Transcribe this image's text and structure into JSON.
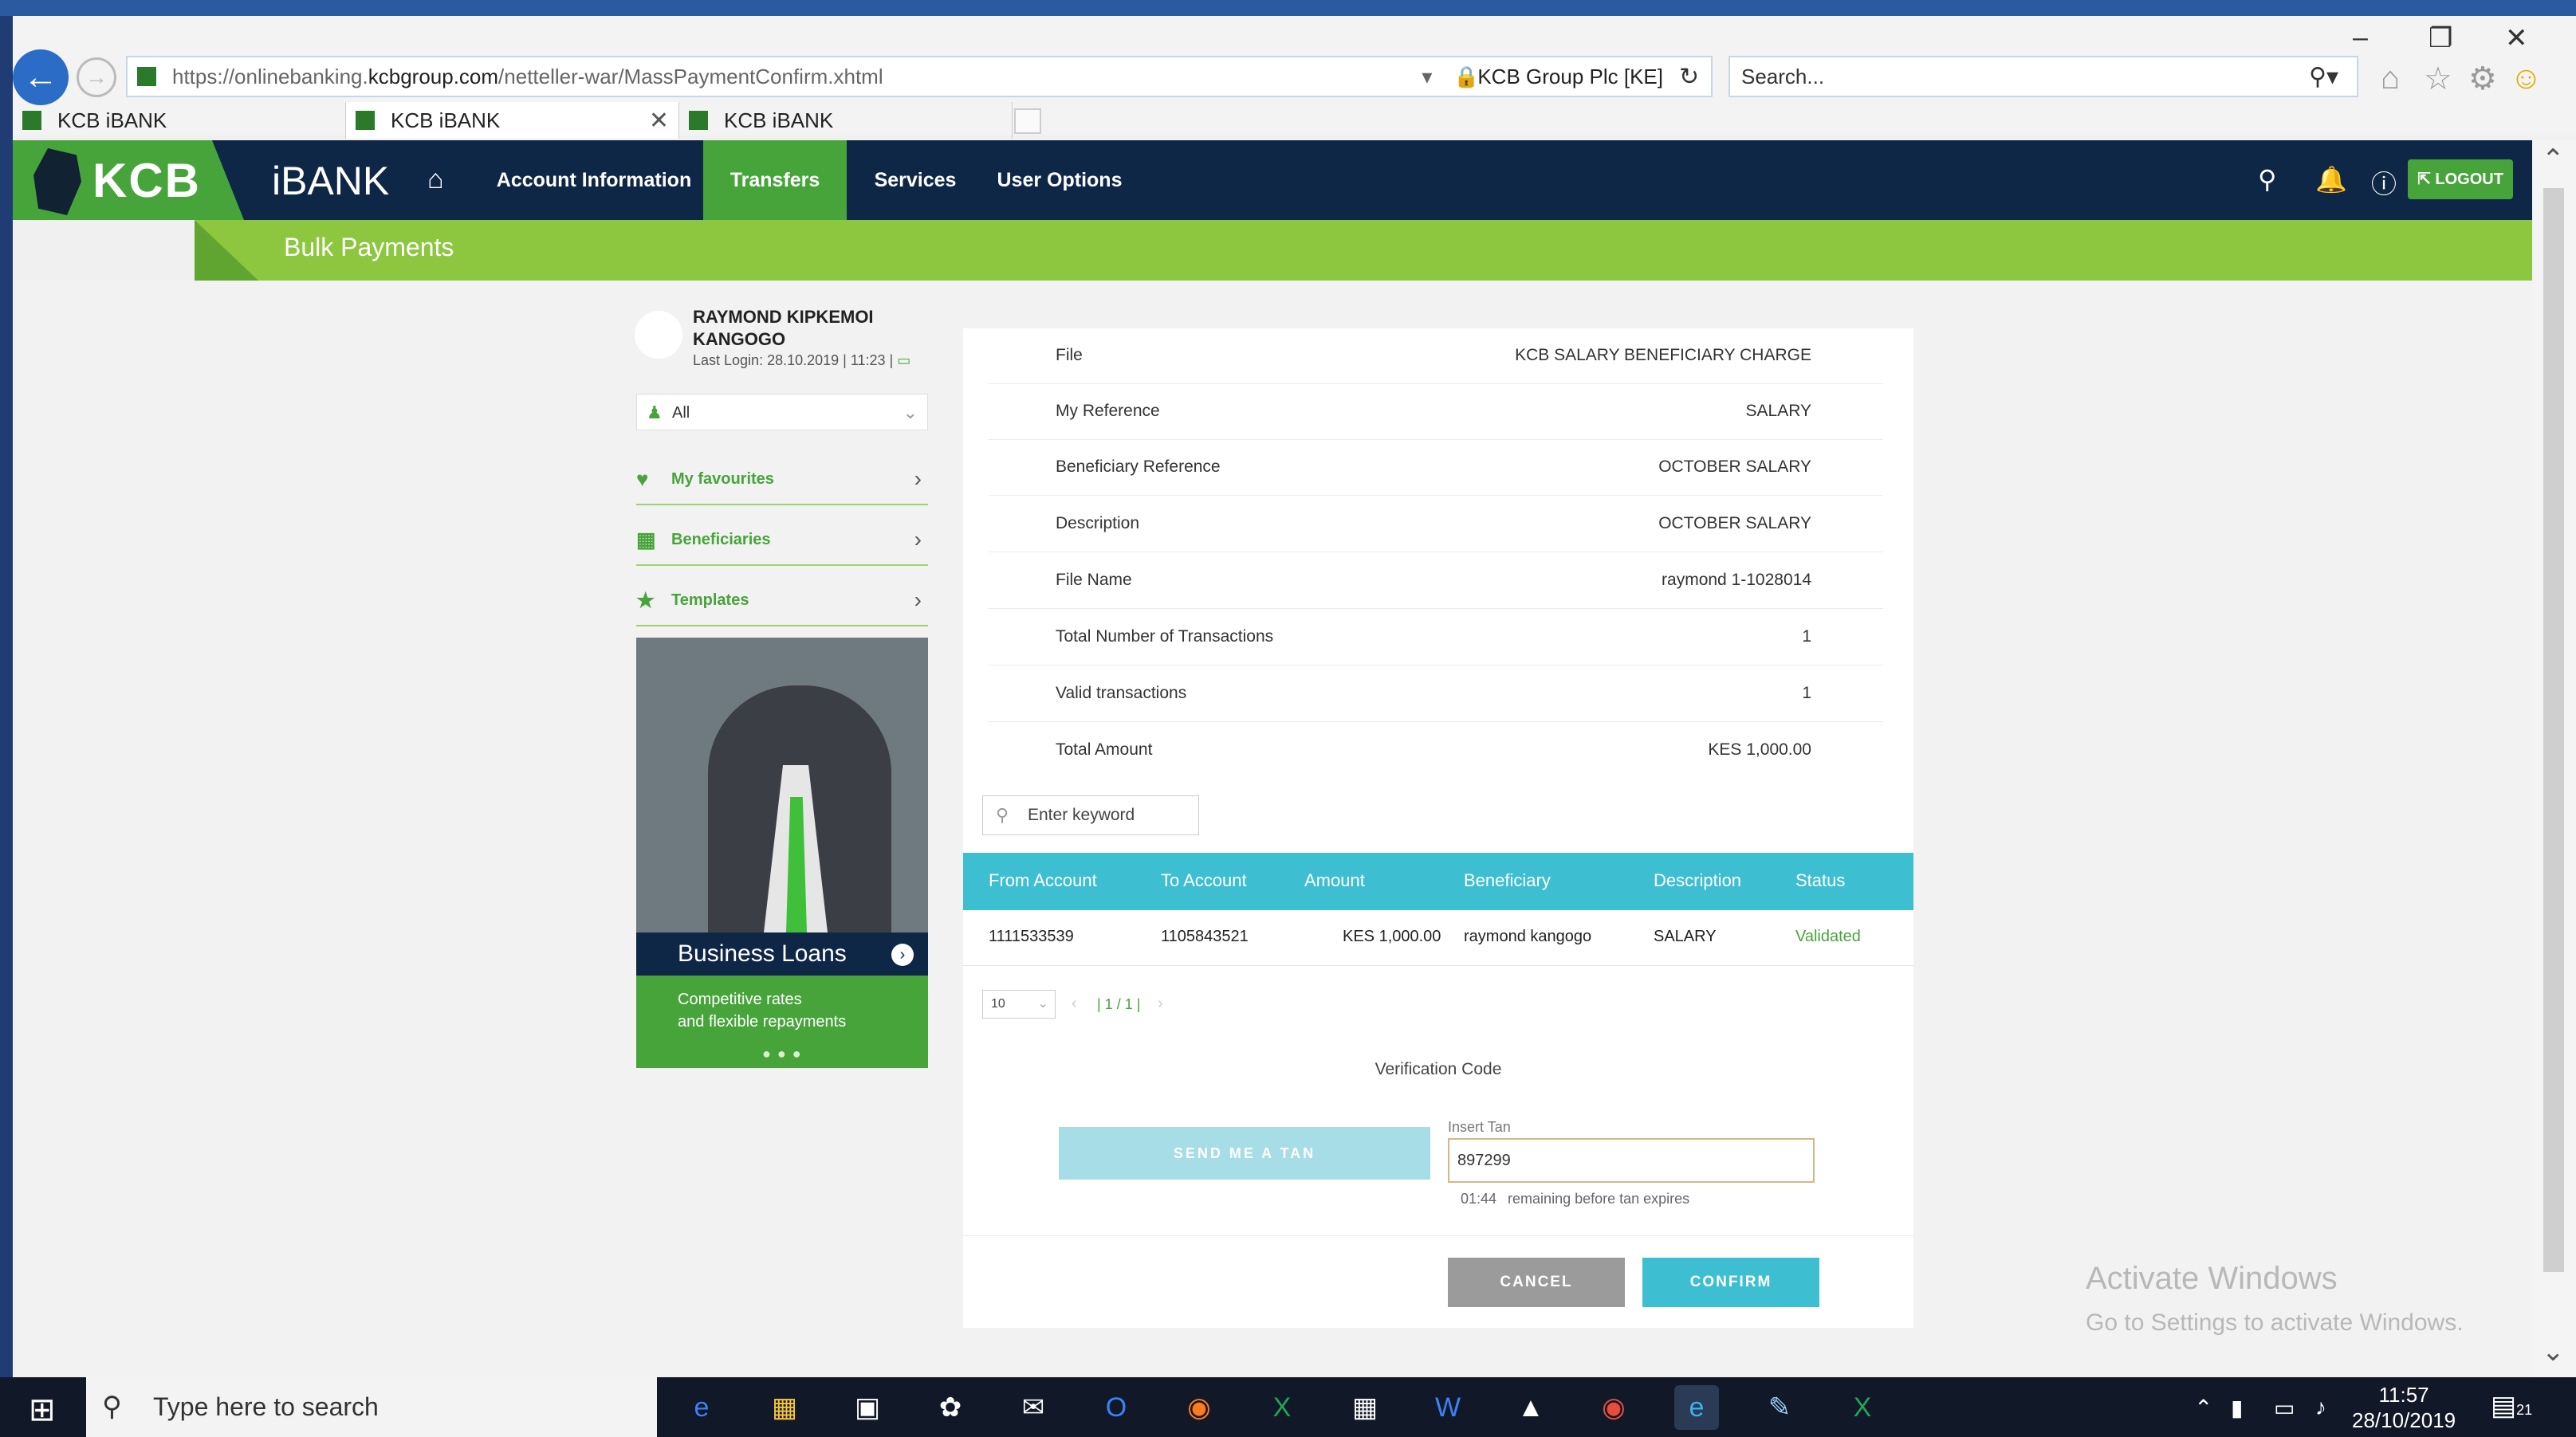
{
  "browser": {
    "url_prefix": "https://onlinebanking.",
    "url_domain": "kcbgroup.com",
    "url_path": "/netteller-war/MassPaymentConfirm.xhtml",
    "site_identity": "KCB Group Plc [KE]",
    "search_placeholder": "Search...",
    "tabs": [
      {
        "label": "KCB iBANK"
      },
      {
        "label": "KCB iBANK"
      },
      {
        "label": "KCB iBANK"
      }
    ]
  },
  "header": {
    "logo": "KCB",
    "product": "iBANK",
    "nav": [
      {
        "label": "Account Information"
      },
      {
        "label": "Transfers"
      },
      {
        "label": "Services"
      },
      {
        "label": "User Options"
      }
    ],
    "logout_label": "LOGOUT"
  },
  "page": {
    "title": "Bulk Payments"
  },
  "sidebar": {
    "user_name": "RAYMOND KIPKEMOI KANGOGO",
    "last_login": "Last Login: 28.10.2019 | 11:23 |",
    "filter_value": "All",
    "links": [
      {
        "label": "My favourites"
      },
      {
        "label": "Beneficiaries"
      },
      {
        "label": "Templates"
      }
    ],
    "promo": {
      "title": "Business  Loans",
      "subtitle_line1": "Competitive rates",
      "subtitle_line2": "and flexible repayments"
    }
  },
  "details": [
    {
      "label": "File",
      "value": "KCB SALARY BENEFICIARY CHARGE"
    },
    {
      "label": "My Reference",
      "value": "SALARY"
    },
    {
      "label": "Beneficiary Reference",
      "value": "OCTOBER SALARY"
    },
    {
      "label": "Description",
      "value": "OCTOBER SALARY"
    },
    {
      "label": "File Name",
      "value": "raymond 1-1028014"
    },
    {
      "label": "Total Number of Transactions",
      "value": "1"
    },
    {
      "label": "Valid transactions",
      "value": "1"
    },
    {
      "label": "Total Amount",
      "value": "KES 1,000.00"
    }
  ],
  "search": {
    "placeholder": "Enter keyword"
  },
  "table": {
    "columns": [
      "From Account",
      "To Account",
      "Amount",
      "Beneficiary",
      "Description",
      "Status"
    ],
    "rows": [
      [
        "1111533539",
        "1105843521",
        "KES 1,000.00",
        "raymond kangogo",
        "SALARY",
        "Validated"
      ]
    ],
    "page_size": "10",
    "page_info": "| 1 / 1 |"
  },
  "verification": {
    "title": "Verification Code",
    "send_tan_label": "SEND ME A TAN",
    "tan_label": "Insert Tan",
    "tan_value": "897299",
    "timer": "01:44",
    "timer_text": "remaining before tan expires"
  },
  "actions": {
    "cancel": "CANCEL",
    "confirm": "CONFIRM"
  },
  "watermark": {
    "line1": "Activate Windows",
    "line2": "Go to Settings to activate Windows."
  },
  "taskbar": {
    "search_placeholder": "Type here to search",
    "time": "11:57",
    "date": "28/10/2019",
    "notifications": "21"
  },
  "colors": {
    "navy": "#0f2747",
    "green": "#47a43a",
    "lime": "#8dc63f",
    "teal": "#3dbfd1"
  }
}
